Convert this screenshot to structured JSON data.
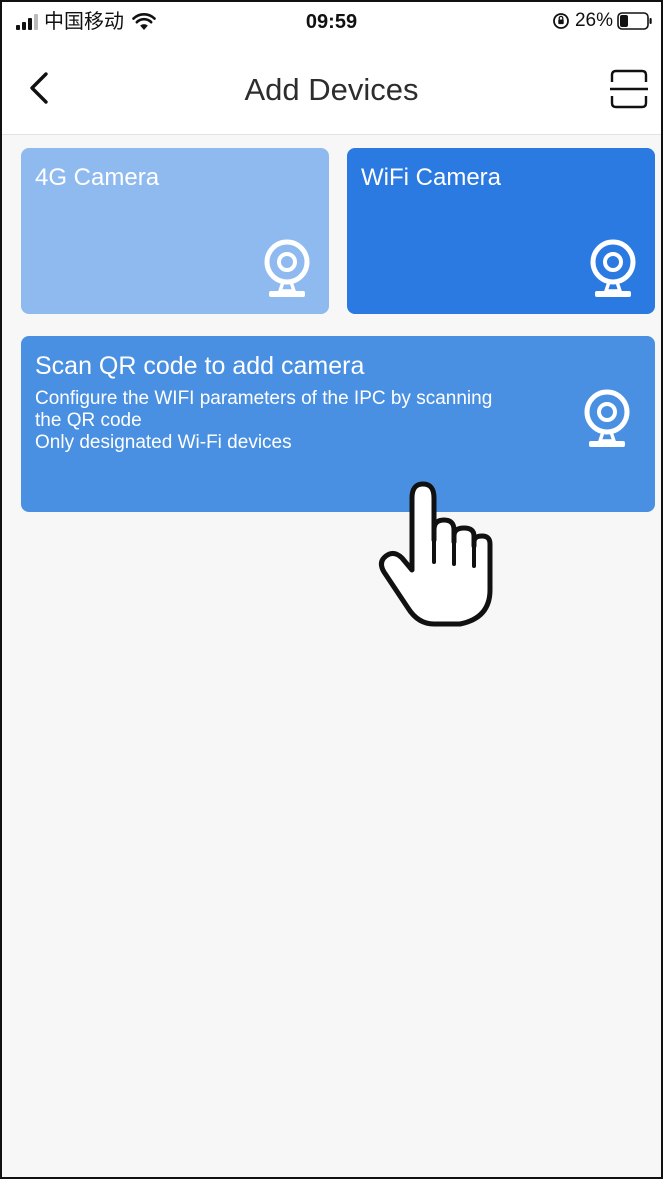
{
  "status_bar": {
    "carrier": "中国移动",
    "time": "09:59",
    "battery": "26%"
  },
  "nav": {
    "title": "Add Devices"
  },
  "cards": {
    "camera_4g": {
      "title": "4G Camera"
    },
    "camera_wifi": {
      "title": "WiFi Camera"
    },
    "scan_qr": {
      "title": "Scan QR code to add camera",
      "desc_line1": "Configure the WIFI parameters of the IPC by scanning",
      "desc_line2": "the QR code",
      "desc_line3": "Only designated Wi-Fi devices"
    }
  },
  "icons": {
    "back": "chevron-left-icon",
    "scan": "scan-frame-icon",
    "camera": "webcam-icon",
    "pointer": "hand-pointer-icon"
  },
  "colors": {
    "card_4g": "#8fbaf0",
    "card_wifi": "#2a7ae2",
    "card_qr": "#4a90e2",
    "background": "#f7f7f7"
  }
}
